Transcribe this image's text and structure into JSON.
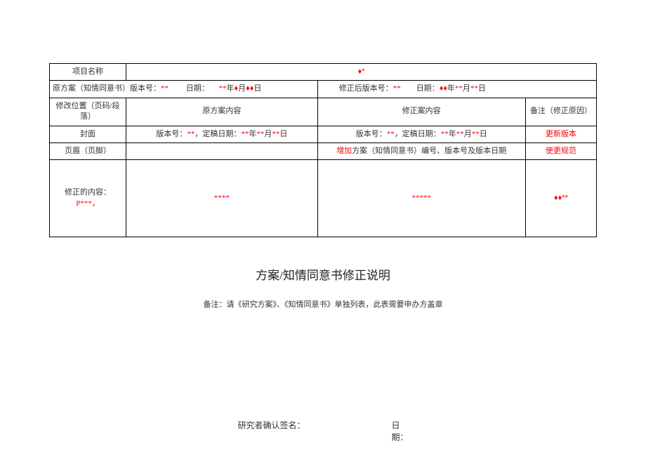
{
  "table": {
    "row1": {
      "label": "项目名称",
      "value_diamond": "♦*"
    },
    "row2": {
      "orig_label": "原方案（知情同意书）版本号：",
      "orig_star": "**",
      "date_label": "日期：",
      "date_val_pre": "**",
      "date_val_y": "年",
      "date_val_m": "月",
      "date_val_d": "日",
      "rev_label": "修正后版本号：",
      "rev_star": "**",
      "rev_date_label": "日期：",
      "rev_date_y": "年",
      "rev_date_m": "月",
      "rev_date_d": "日"
    },
    "hdr": {
      "c1": "修改位置（页码/段落）",
      "c2": "原方案内容",
      "c3": "修正案内容",
      "c4": "备注（修正原因）"
    },
    "r_cover": {
      "c1": "封面",
      "c2_a": "版本号：",
      "c2_b": "**",
      "c2_c": "，定稿日期：",
      "c2_d": "**",
      "c2_e": "年",
      "c2_f": "**",
      "c2_g": "月",
      "c2_h": "**",
      "c2_i": "日",
      "c3_a": "版本号：",
      "c3_b": "**",
      "c3_c": "，定稿日期：",
      "c3_d": "**",
      "c3_e": "年",
      "c3_f": "**",
      "c3_g": "月",
      "c3_h": "**",
      "c3_i": "日",
      "c4": "更新版本"
    },
    "r_header": {
      "c1": "页眉（页脚）",
      "c2": "",
      "c3_a": "增加",
      "c3_b": "方案（知情同意书）编号、版本号及版本日期",
      "c4": "使更规范"
    },
    "r_content": {
      "c1_a": "修正的内容：",
      "c1_b": "P***",
      "c1_c": "，",
      "c2": "****",
      "c3": "*****",
      "c4": "♦♦**"
    }
  },
  "title": "方案/知情同意书修正说明",
  "note": "备注：请《研究方案》、《知情同意书》单独列表，此表需要申办方盖章",
  "footer": {
    "sig": "研究者确认签名：",
    "date1": "日",
    "date2": "期："
  }
}
